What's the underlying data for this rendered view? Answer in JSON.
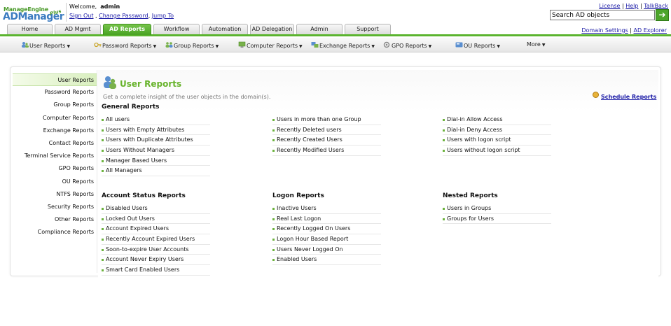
{
  "header": {
    "logo_top": "ManageEngine",
    "logo_main": "ADManager",
    "logo_plus": "Plus",
    "welcome_label": "Welcome,",
    "user": "admin",
    "sign_out": "Sign Out",
    "change_password": "Change Password",
    "jump_to": "Jump To",
    "license": "License",
    "help": "Help",
    "talkback": "TalkBack",
    "search_placeholder": "Search AD objects",
    "search_value": "Search AD objects",
    "search_go": "➔",
    "domain_settings": "Domain Settings",
    "ad_explorer": "AD Explorer"
  },
  "tabs": [
    {
      "label": "Home"
    },
    {
      "label": "AD Mgmt"
    },
    {
      "label": "AD Reports"
    },
    {
      "label": "Workflow"
    },
    {
      "label": "Automation"
    },
    {
      "label": "AD Delegation"
    },
    {
      "label": "Admin"
    },
    {
      "label": "Support"
    }
  ],
  "submenu": [
    {
      "label": "User Reports",
      "icon": "users-icon"
    },
    {
      "label": "Password Reports",
      "icon": "key-icon"
    },
    {
      "label": "Group Reports",
      "icon": "group-icon"
    },
    {
      "label": "Computer Reports",
      "icon": "computer-icon"
    },
    {
      "label": "Exchange Reports",
      "icon": "exchange-icon"
    },
    {
      "label": "GPO Reports",
      "icon": "gpo-icon"
    },
    {
      "label": "OU Reports",
      "icon": "ou-icon"
    },
    {
      "label": "More"
    }
  ],
  "left_nav": [
    "User Reports",
    "Password Reports",
    "Group Reports",
    "Computer Reports",
    "Exchange Reports",
    "Contact Reports",
    "Terminal Service Reports",
    "GPO Reports",
    "OU Reports",
    "NTFS Reports",
    "Security Reports",
    "Other Reports",
    "Compliance Reports"
  ],
  "main": {
    "title": "User Reports",
    "description": "Get a complete insight of the user objects in the domain(s).",
    "schedule": "Schedule Reports",
    "general_title": "General Reports",
    "general_col1": [
      "All users",
      "Users with Empty Attributes",
      "Users with Duplicate Attributes",
      "Users Without Managers",
      "Manager Based Users",
      "All Managers"
    ],
    "general_col2": [
      "Users in more than one Group",
      "Recently Deleted users",
      "Recently Created Users",
      "Recently Modified Users"
    ],
    "general_col3": [
      "Dial-in Allow Access",
      "Dial-in Deny Access",
      "Users with logon script",
      "Users without logon script"
    ],
    "account_title": "Account Status Reports",
    "account": [
      "Disabled Users",
      "Locked Out Users",
      "Account Expired Users",
      "Recently Account Expired Users",
      "Soon-to-expire User Accounts",
      "Account Never Expiry Users",
      "Smart Card Enabled Users"
    ],
    "logon_title": "Logon Reports",
    "logon": [
      "Inactive Users",
      "Real Last Logon",
      "Recently Logged On Users",
      "Logon Hour Based Report",
      "Users Never Logged On",
      "Enabled Users"
    ],
    "nested_title": "Nested Reports",
    "nested": [
      "Users in Groups",
      "Groups for Users"
    ]
  },
  "colors": {
    "accent": "#5bb42f",
    "title": "#67b32b",
    "link": "#1a1aa6"
  }
}
